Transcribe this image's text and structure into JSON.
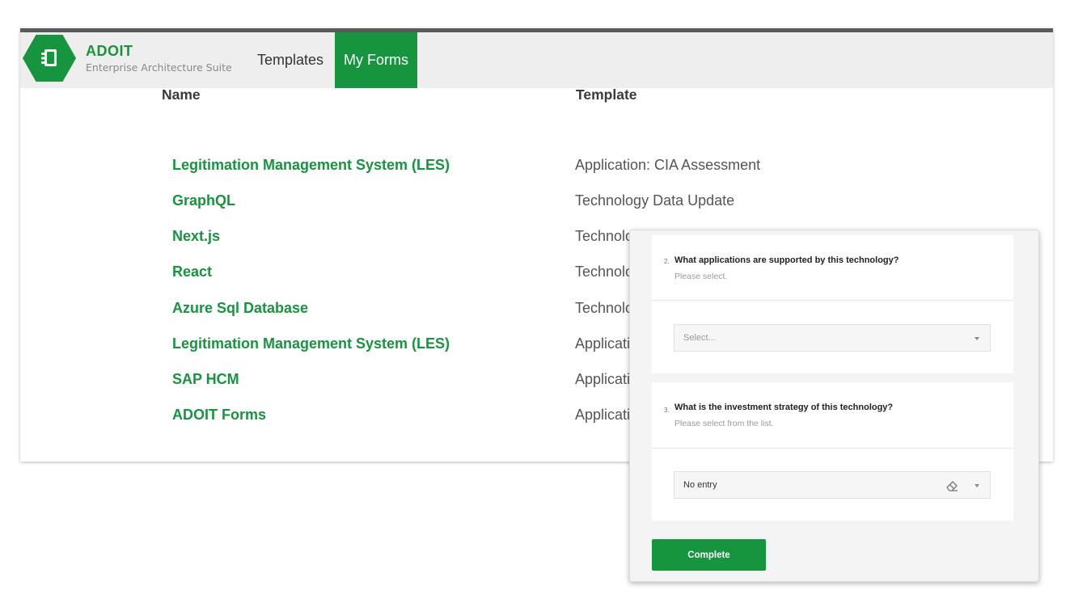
{
  "app": {
    "brand": "ADOIT",
    "subtitle": "Enterprise Architecture Suite",
    "accent_color": "#16943e"
  },
  "nav": {
    "tabs": [
      {
        "label": "Templates",
        "active": false
      },
      {
        "label": "My Forms",
        "active": true
      }
    ]
  },
  "table": {
    "headers": {
      "name": "Name",
      "template": "Template"
    },
    "rows": [
      {
        "name": "Legitimation Management System (LES)",
        "template": "Application: CIA Assessment"
      },
      {
        "name": "GraphQL",
        "template": "Technology Data Update"
      },
      {
        "name": "Next.js",
        "template": "Technolo"
      },
      {
        "name": "React",
        "template": "Technolo"
      },
      {
        "name": "Azure Sql Database",
        "template": "Technolo"
      },
      {
        "name": "Legitimation Management System (LES)",
        "template": "Applicati"
      },
      {
        "name": "SAP HCM",
        "template": "Applicati"
      },
      {
        "name": "ADOIT Forms",
        "template": "Applicati"
      }
    ]
  },
  "form": {
    "questions": [
      {
        "number": "2.",
        "title": "What applications are supported by this technology?",
        "hint": "Please select.",
        "placeholder": "Select..."
      },
      {
        "number": "3.",
        "title": "What is the investment strategy of this technology?",
        "hint": "Please select from the list.",
        "value": "No entry"
      }
    ],
    "complete_label": "Complete"
  },
  "icons": {
    "logo": "form-book-icon",
    "clear": "eraser-icon",
    "dropdown": "caret-down-icon"
  }
}
